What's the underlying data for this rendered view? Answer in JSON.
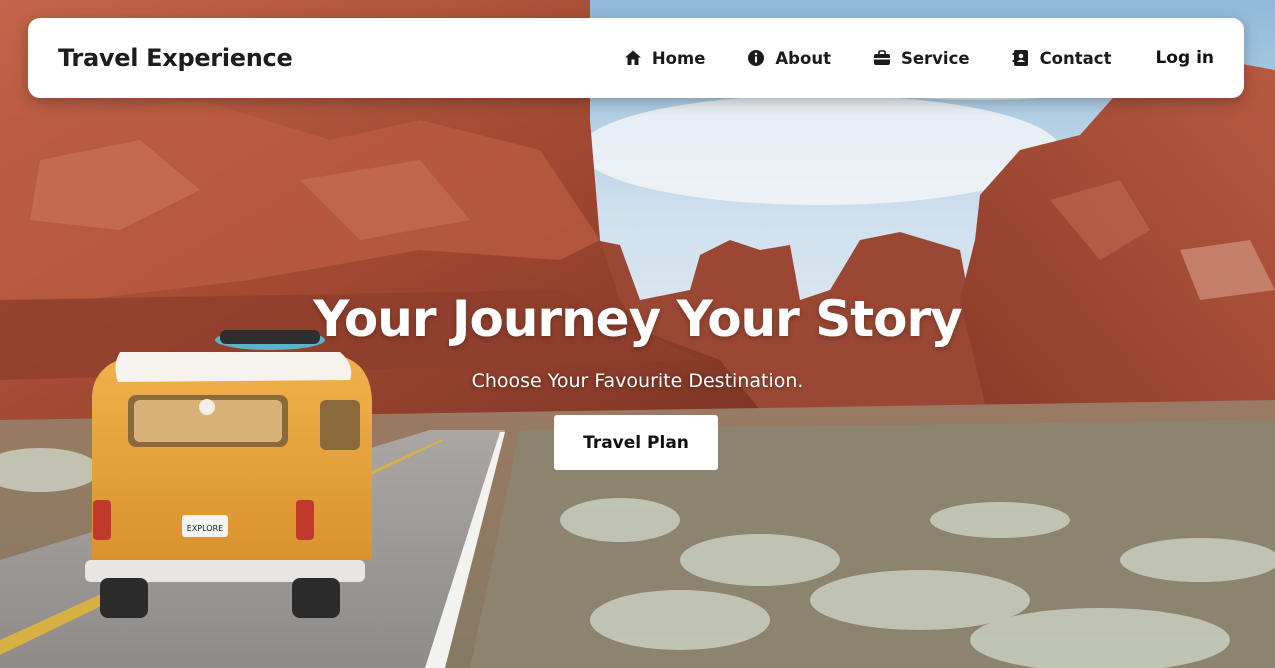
{
  "brand": {
    "title": "Travel Experience"
  },
  "nav": {
    "items": [
      {
        "label": "Home",
        "icon": "home-icon"
      },
      {
        "label": "About",
        "icon": "info-icon"
      },
      {
        "label": "Service",
        "icon": "briefcase-icon"
      },
      {
        "label": "Contact",
        "icon": "contact-book-icon"
      }
    ],
    "login_label": "Log in"
  },
  "hero": {
    "title": "Your Journey Your Story",
    "subtitle": "Choose Your Favourite Destination.",
    "cta_label": "Travel Plan",
    "van_plate": "EXPLORE"
  },
  "colors": {
    "navbar_bg": "#ffffff",
    "text_dark": "#1b1b1b",
    "hero_text": "#ffffff",
    "rock": "#a8523a",
    "van": "#e8a640"
  }
}
